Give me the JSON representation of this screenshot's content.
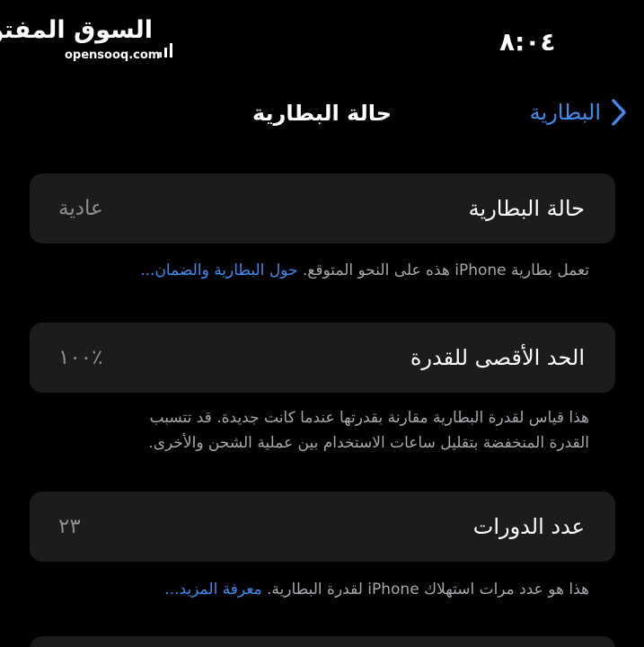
{
  "status_bar": {
    "time": "٨:٠٤"
  },
  "watermark": {
    "brand": "السوق المفتوح",
    "site": "opensooq.com"
  },
  "nav": {
    "back_label": "البطارية",
    "title": "حالة البطارية"
  },
  "sections": {
    "health": {
      "label": "حالة البطارية",
      "value": "عادية",
      "note": "تعمل بطارية iPhone هذه على النحو المتوقع.",
      "link": "حول البطارية والضمان..."
    },
    "capacity": {
      "label": "الحد الأقصى للقدرة",
      "value": "٪١٠٠",
      "note_line1": "هذا قياس لقدرة البطارية مقارنة بقدرتها عندما كانت جديدة. قد تتسبب",
      "note_line2": "القدرة المنخفضة بتقليل ساعات الاستخدام بين عملية الشحن والأخرى."
    },
    "cycles": {
      "label": "عدد الدورات",
      "value": "٢٣",
      "note": "هذا هو عدد مرات استهلاك iPhone لقدرة البطارية.",
      "link": "معرفة المزيد..."
    }
  },
  "colors": {
    "background": "#000000",
    "card": "#1c1c1e",
    "accent": "#3f8cf0",
    "secondary_text": "#8e8e93"
  },
  "icons": {
    "back": "chevron-right-icon",
    "brand": "signal-bars-icon"
  }
}
